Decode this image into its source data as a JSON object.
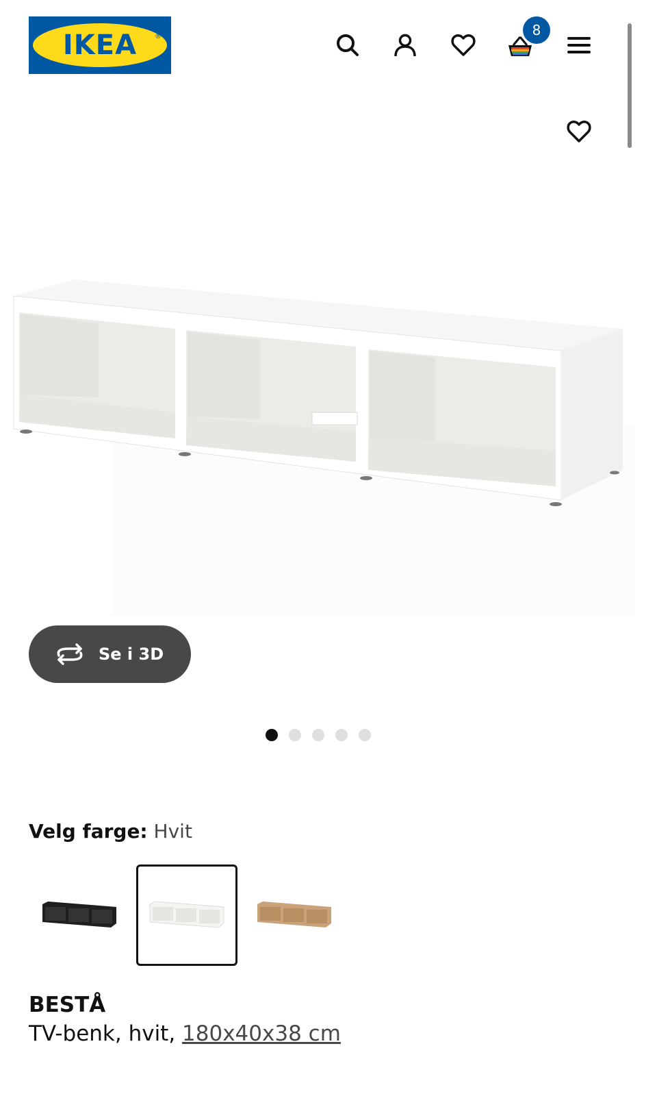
{
  "header": {
    "logo_text": "IKEA",
    "cart_count": "8",
    "icons": [
      "search-icon",
      "user-icon",
      "heart-icon",
      "cart-icon",
      "menu-icon"
    ]
  },
  "gallery": {
    "see_3d_label": "Se i 3D",
    "slide_count": 5,
    "active_slide": 1
  },
  "product": {
    "color_label": "Velg farge:",
    "color_value": "Hvit",
    "swatches": [
      {
        "name": "Svart",
        "color": "#1f1f1f",
        "selected": false
      },
      {
        "name": "Hvit",
        "color": "#f2f2f0",
        "selected": true
      },
      {
        "name": "Eik",
        "color": "#c9a27a",
        "selected": false
      }
    ],
    "name": "BESTÅ",
    "description": "TV-benk, hvit,",
    "dimensions": "180x40x38 cm"
  },
  "colors": {
    "brand_blue": "#0058a3",
    "brand_yellow": "#ffda1a",
    "button_dark": "#484848"
  }
}
